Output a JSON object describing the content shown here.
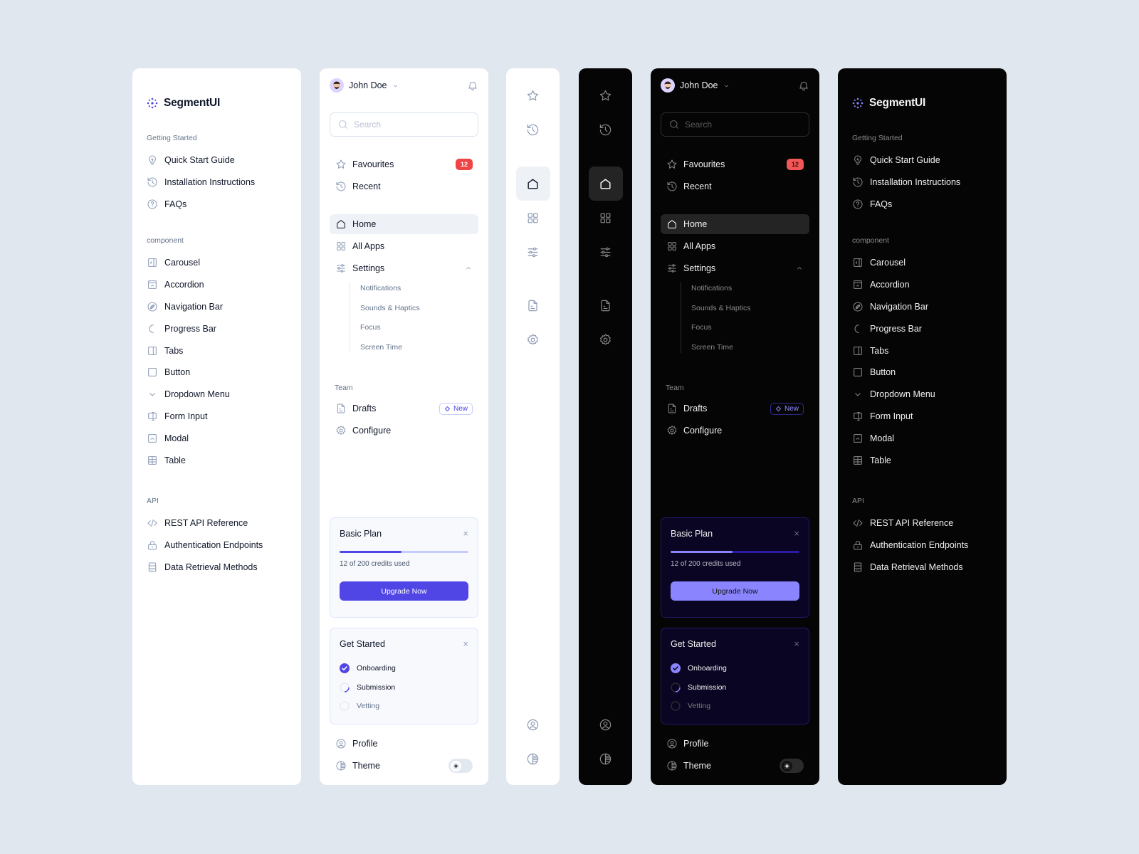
{
  "docs_sidebar": {
    "brand": "SegmentUI",
    "sections": [
      {
        "title": "Getting Started",
        "items": [
          {
            "label": "Quick Start Guide",
            "icon": "lightbulb-icon"
          },
          {
            "label": "Installation Instructions",
            "icon": "history-icon"
          },
          {
            "label": "FAQs",
            "icon": "help-circle-icon"
          }
        ]
      },
      {
        "title": "component",
        "items": [
          {
            "label": "Carousel",
            "icon": "carousel-icon"
          },
          {
            "label": "Accordion",
            "icon": "accordion-icon"
          },
          {
            "label": "Navigation Bar",
            "icon": "compass-icon"
          },
          {
            "label": "Progress Bar",
            "icon": "progress-arc-icon"
          },
          {
            "label": "Tabs",
            "icon": "tabs-icon"
          },
          {
            "label": "Button",
            "icon": "square-icon"
          },
          {
            "label": "Dropdown Menu",
            "icon": "chevron-down-icon"
          },
          {
            "label": "Form Input",
            "icon": "text-cursor-input-icon"
          },
          {
            "label": "Modal",
            "icon": "modal-icon"
          },
          {
            "label": "Table",
            "icon": "table-icon"
          }
        ]
      },
      {
        "title": "API",
        "items": [
          {
            "label": "REST API Reference",
            "icon": "code-icon"
          },
          {
            "label": "Authentication Endpoints",
            "icon": "lock-icon"
          },
          {
            "label": "Data Retrieval Methods",
            "icon": "database-icon"
          }
        ]
      }
    ]
  },
  "app_sidebar": {
    "user_name": "John Doe",
    "search_placeholder": "Search",
    "favourites_label": "Favourites",
    "favourites_count": "12",
    "recent_label": "Recent",
    "home_label": "Home",
    "all_apps_label": "All Apps",
    "settings_label": "Settings",
    "settings_children": [
      "Notifications",
      "Sounds & Haptics",
      "Focus",
      "Screen Time"
    ],
    "team_title": "Team",
    "drafts_label": "Drafts",
    "new_badge": "New",
    "configure_label": "Configure",
    "plan_card": {
      "title": "Basic Plan",
      "credits_used": 12,
      "credits_total": 200,
      "credits_text": "12 of 200 credits used",
      "progress_fraction": 0.48,
      "upgrade_label": "Upgrade Now",
      "close_glyph": "×"
    },
    "get_started_card": {
      "title": "Get Started",
      "close_glyph": "×",
      "tasks": [
        {
          "label": "Onboarding",
          "status": "done"
        },
        {
          "label": "Submission",
          "status": "in-progress"
        },
        {
          "label": "Vetting",
          "status": "pending"
        }
      ]
    },
    "profile_label": "Profile",
    "theme_label": "Theme"
  },
  "icon_rail": {
    "items": [
      "star-icon",
      "history-icon",
      "home-icon",
      "grid-icon",
      "sliders-icon",
      "file-icon",
      "gear-icon",
      "user-circle-icon",
      "contrast-icon"
    ],
    "active": "home-icon"
  },
  "colors": {
    "background": "#e1e7ef",
    "accent_light": "#5046e6",
    "accent_dark": "#8a85ff",
    "badge_red": "#ef4444"
  }
}
